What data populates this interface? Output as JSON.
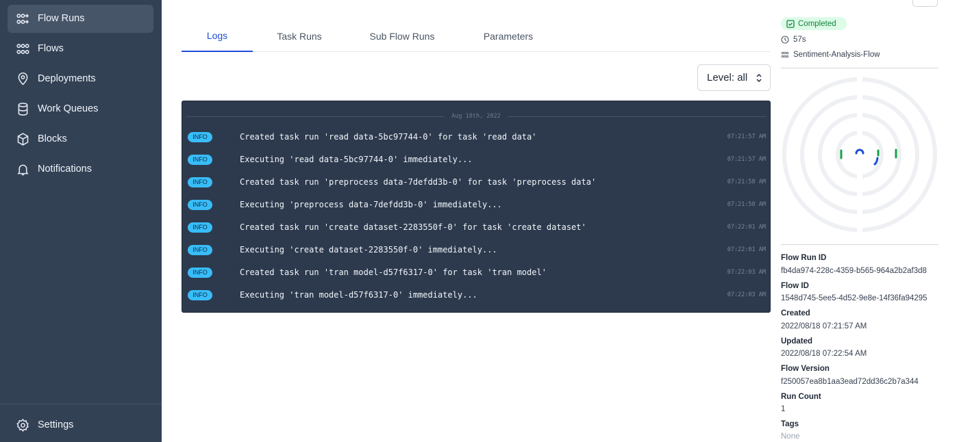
{
  "sidebar": {
    "items": [
      {
        "label": "Flow Runs",
        "icon": "flow-runs-icon",
        "active": true
      },
      {
        "label": "Flows",
        "icon": "flows-icon"
      },
      {
        "label": "Deployments",
        "icon": "map-pin-icon"
      },
      {
        "label": "Work Queues",
        "icon": "database-icon"
      },
      {
        "label": "Blocks",
        "icon": "cube-icon"
      },
      {
        "label": "Notifications",
        "icon": "bell-icon"
      }
    ],
    "settings": {
      "label": "Settings",
      "icon": "gear-icon"
    }
  },
  "tabs": [
    {
      "label": "Logs",
      "active": true
    },
    {
      "label": "Task Runs"
    },
    {
      "label": "Sub Flow Runs"
    },
    {
      "label": "Parameters"
    }
  ],
  "level_select": {
    "value": "Level: all"
  },
  "logs": {
    "date": "Aug 18th, 2022",
    "rows": [
      {
        "level": "INFO",
        "message": "Created task run 'read data-5bc97744-0' for task 'read data'",
        "time": "07:21:57 AM"
      },
      {
        "level": "INFO",
        "message": "Executing 'read data-5bc97744-0' immediately...",
        "time": "07:21:57 AM"
      },
      {
        "level": "INFO",
        "message": "Created task run 'preprocess data-7defdd3b-0' for task 'preprocess data'",
        "time": "07:21:58 AM"
      },
      {
        "level": "INFO",
        "message": "Executing 'preprocess data-7defdd3b-0' immediately...",
        "time": "07:21:58 AM"
      },
      {
        "level": "INFO",
        "message": "Created task run 'create dataset-2283550f-0' for task 'create dataset'",
        "time": "07:22:01 AM"
      },
      {
        "level": "INFO",
        "message": "Executing 'create dataset-2283550f-0' immediately...",
        "time": "07:22:01 AM"
      },
      {
        "level": "INFO",
        "message": "Created task run 'tran model-d57f6317-0' for task 'tran model'",
        "time": "07:22:03 AM"
      },
      {
        "level": "INFO",
        "message": "Executing 'tran model-d57f6317-0' immediately...",
        "time": "07:22:03 AM"
      }
    ]
  },
  "details": {
    "status": "Completed",
    "status_color": "#15803d",
    "duration": "57s",
    "flow_name": "Sentiment-Analysis-Flow",
    "fields": [
      {
        "label": "Flow Run ID",
        "value": "fb4da974-228c-4359-b565-964a2b2af3d8"
      },
      {
        "label": "Flow ID",
        "value": "1548d745-5ee5-4d52-9e8e-14f36fa94295"
      },
      {
        "label": "Created",
        "value": "2022/08/18 07:21:57 AM"
      },
      {
        "label": "Updated",
        "value": "2022/08/18 07:22:54 AM"
      },
      {
        "label": "Flow Version",
        "value": "f250057ea8b1aa3ead72dd36c2b7a344"
      },
      {
        "label": "Run Count",
        "value": "1"
      },
      {
        "label": "Tags",
        "value": "None"
      }
    ]
  },
  "colors": {
    "sidebar_bg": "#334155",
    "accent": "#1d4ed8",
    "log_panel_bg": "#2d3a4e",
    "info_badge": "#38bdf8"
  }
}
